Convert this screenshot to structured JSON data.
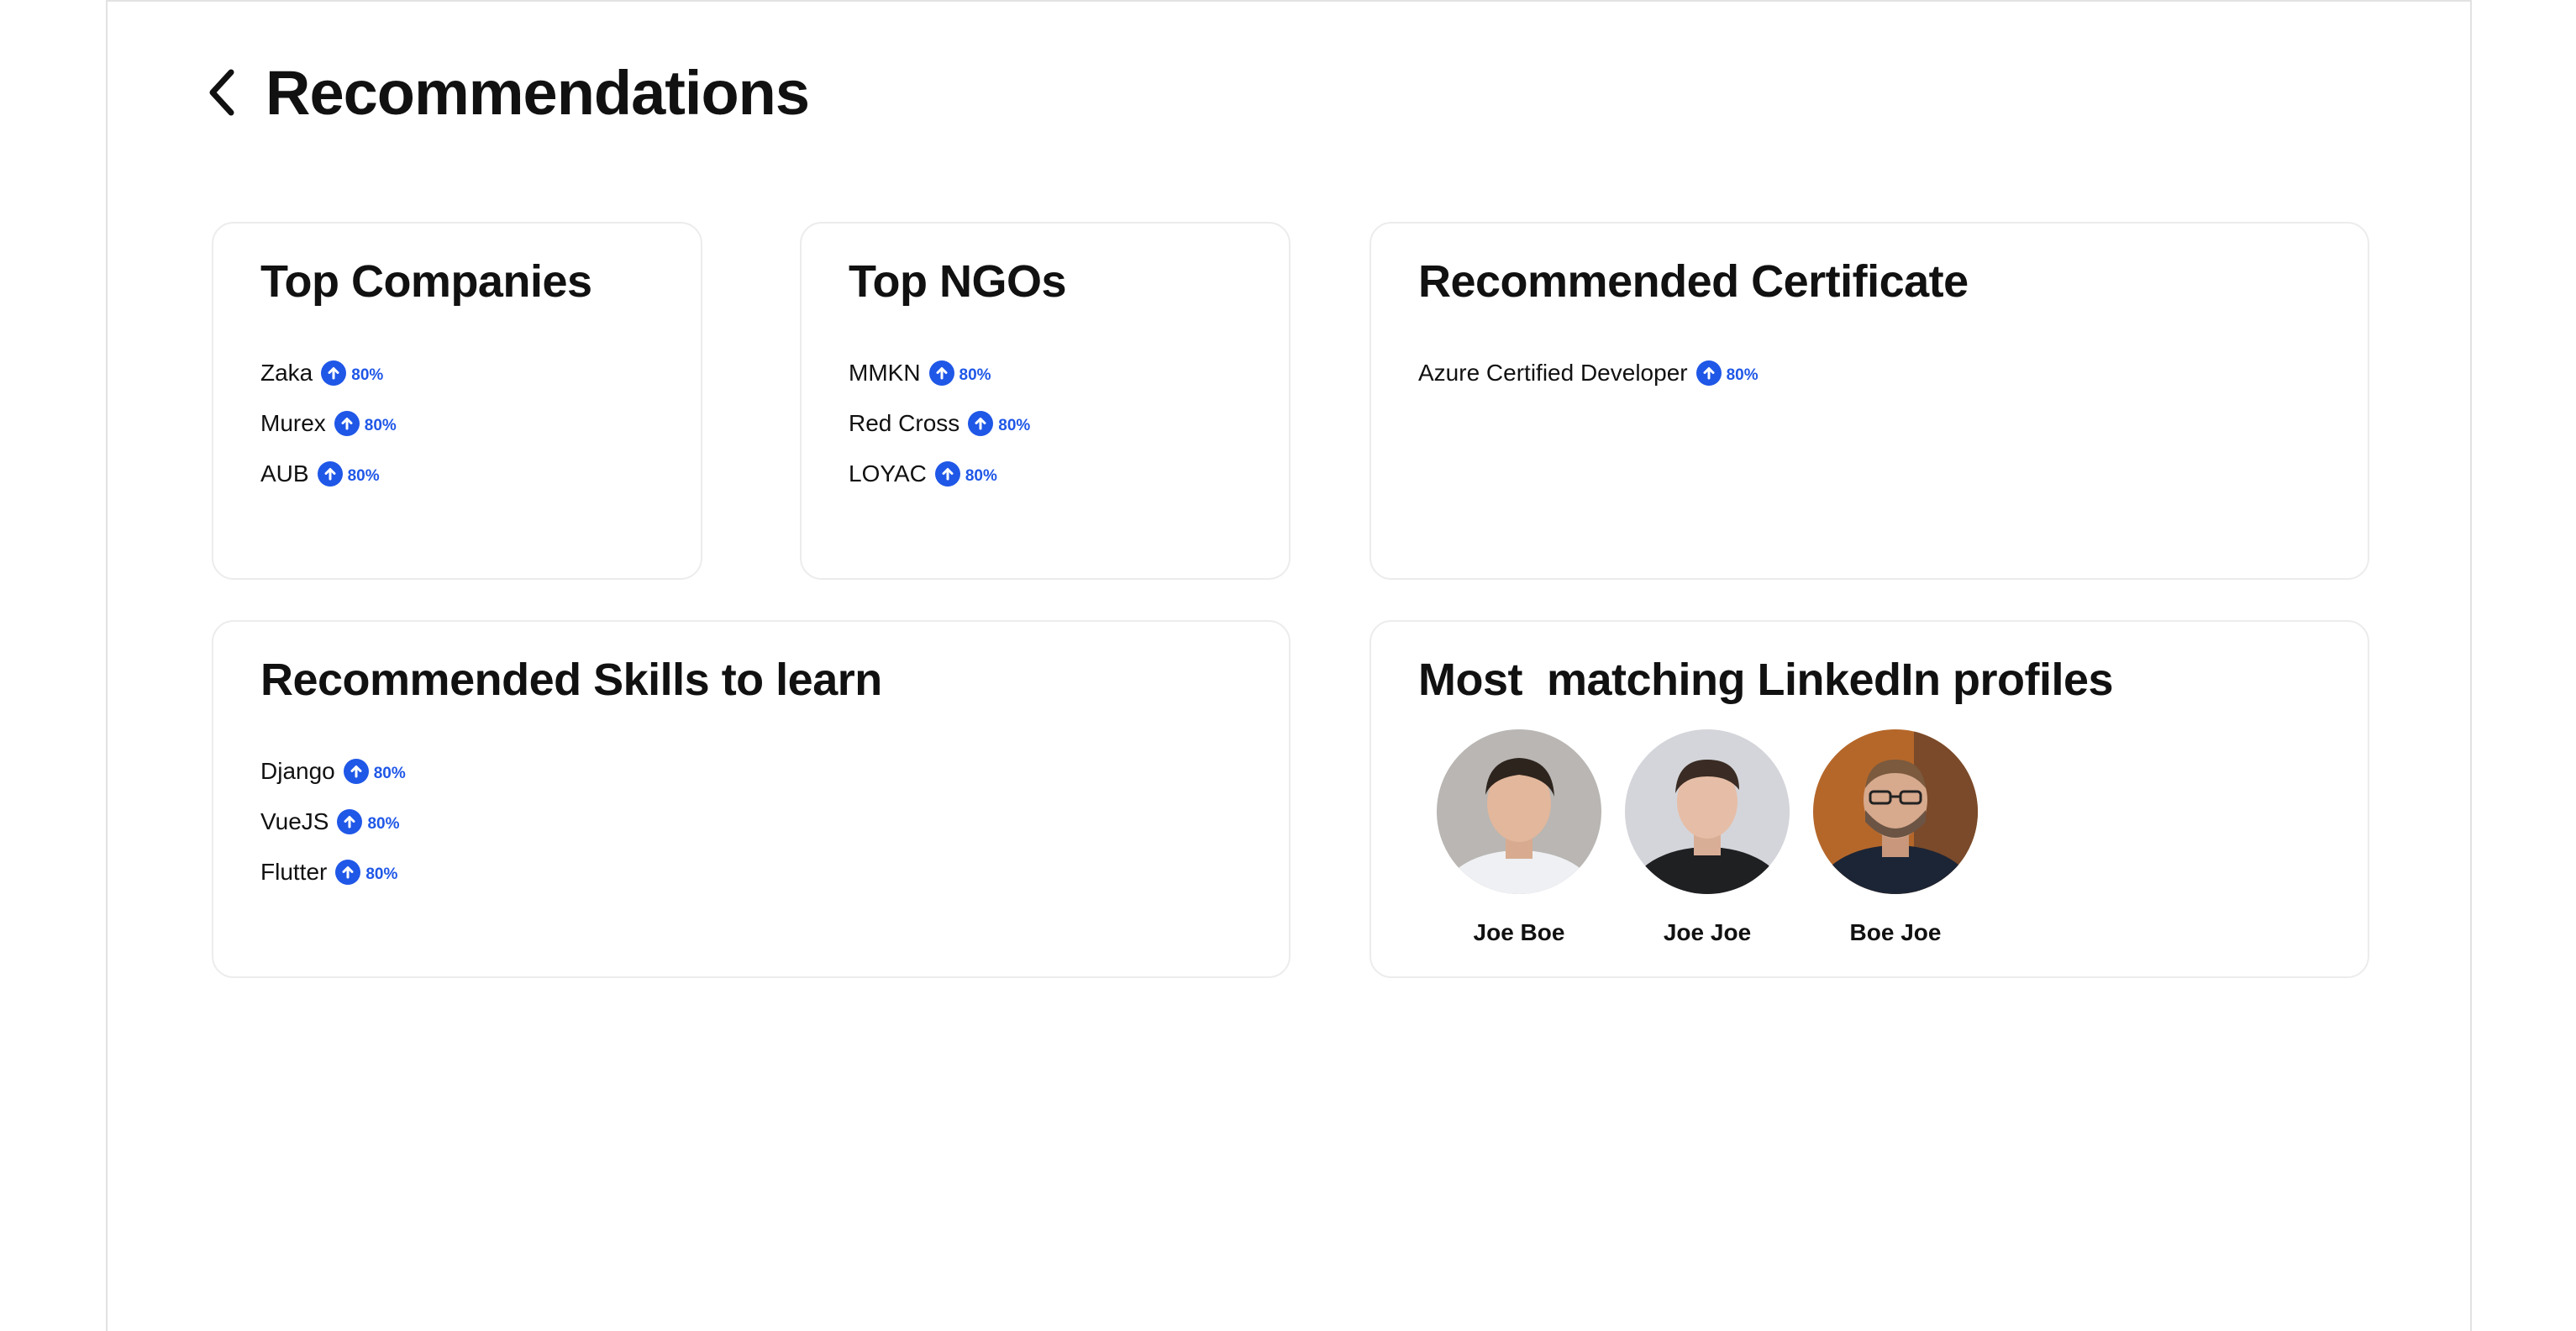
{
  "header": {
    "title": "Recommendations"
  },
  "top_companies": {
    "title": "Top Companies",
    "items": [
      {
        "label": "Zaka",
        "score": "80%"
      },
      {
        "label": "Murex",
        "score": "80%"
      },
      {
        "label": "AUB",
        "score": "80%"
      }
    ]
  },
  "top_ngos": {
    "title": "Top NGOs",
    "items": [
      {
        "label": "MMKN",
        "score": "80%"
      },
      {
        "label": "Red Cross",
        "score": "80%"
      },
      {
        "label": "LOYAC",
        "score": "80%"
      }
    ]
  },
  "recommended_certificate": {
    "title": "Recommended Certificate",
    "items": [
      {
        "label": "Azure Certified Developer",
        "score": "80%"
      }
    ]
  },
  "recommended_skills": {
    "title": "Recommended Skills to learn",
    "items": [
      {
        "label": "Django",
        "score": "80%"
      },
      {
        "label": "VueJS",
        "score": "80%"
      },
      {
        "label": "Flutter",
        "score": "80%"
      }
    ]
  },
  "linkedin_profiles": {
    "title": "Most  matching LinkedIn profiles",
    "profiles": [
      {
        "name": "Joe Boe"
      },
      {
        "name": "Joe Joe"
      },
      {
        "name": "Boe Joe"
      }
    ]
  },
  "colors": {
    "accent": "#1f57e7",
    "border": "#ececec",
    "text": "#111111"
  },
  "icons": {
    "back": "chevron-left-icon",
    "score": "arrow-up-circle-icon"
  }
}
